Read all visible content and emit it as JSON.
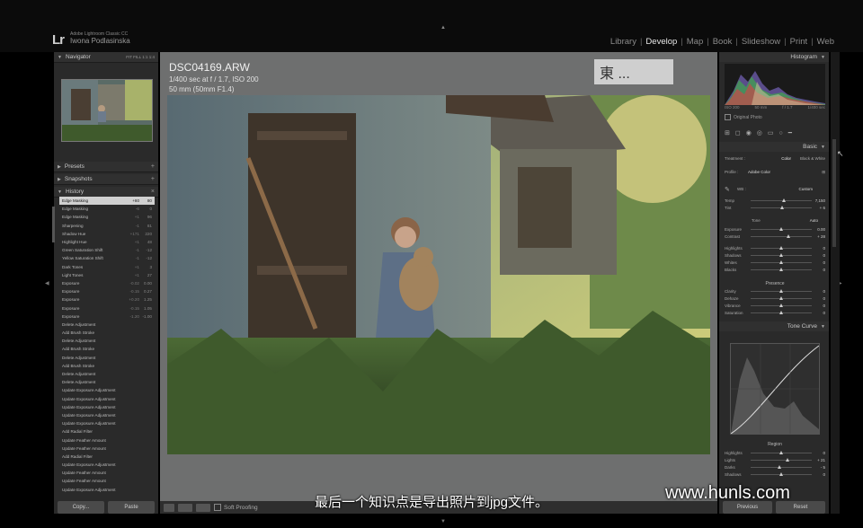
{
  "identity": {
    "small": "Adobe Lightroom Classic CC",
    "name": "Iwona Podlasinska",
    "logo": "Lr"
  },
  "modules": [
    "Library",
    "Develop",
    "Map",
    "Book",
    "Slideshow",
    "Print",
    "Web"
  ],
  "active_module": "Develop",
  "left": {
    "navigator": {
      "title": "Navigator",
      "zoom": "FIT  FILL  1:1  1:4"
    },
    "presets": "Presets",
    "snapshots": "Snapshots",
    "history": {
      "title": "History",
      "rows": [
        {
          "label": "Edge Masking",
          "v1": "+80",
          "v2": "80",
          "selected": true
        },
        {
          "label": "Edge Masking",
          "v1": "-6",
          "v2": "0"
        },
        {
          "label": "Edge Masking",
          "v1": "+1",
          "v2": "96"
        },
        {
          "label": "Sharpening",
          "v1": "-1",
          "v2": "81"
        },
        {
          "label": "Shadow Hue",
          "v1": "+171",
          "v2": "220"
        },
        {
          "label": "Highlight Hue",
          "v1": "+1",
          "v2": "48"
        },
        {
          "label": "Green Saturation Shift",
          "v1": "-1",
          "v2": "-12"
        },
        {
          "label": "Yellow Saturation Shift",
          "v1": "-1",
          "v2": "-12"
        },
        {
          "label": "Dark Tones",
          "v1": "+1",
          "v2": "3"
        },
        {
          "label": "Light Tones",
          "v1": "+1",
          "v2": "27"
        },
        {
          "label": "Exposure",
          "v1": "-0.02",
          "v2": "0.00"
        },
        {
          "label": "Exposure",
          "v1": "-0.15",
          "v2": "0.27"
        },
        {
          "label": "Exposure",
          "v1": "+0.20",
          "v2": "1.25"
        },
        {
          "label": "Exposure",
          "v1": "-0.15",
          "v2": "1.05"
        },
        {
          "label": "Exposure",
          "v1": "-1.20",
          "v2": "-1.00"
        },
        {
          "label": "Delete Adjustment",
          "v1": "",
          "v2": ""
        },
        {
          "label": "Add Brush Stroke",
          "v1": "",
          "v2": ""
        },
        {
          "label": "Delete Adjustment",
          "v1": "",
          "v2": ""
        },
        {
          "label": "Add Brush Stroke",
          "v1": "",
          "v2": ""
        },
        {
          "label": "Delete Adjustment",
          "v1": "",
          "v2": ""
        },
        {
          "label": "Add Brush Stroke",
          "v1": "",
          "v2": ""
        },
        {
          "label": "Delete Adjustment",
          "v1": "",
          "v2": ""
        },
        {
          "label": "Delete Adjustment",
          "v1": "",
          "v2": ""
        },
        {
          "label": "Update Exposure Adjustment",
          "v1": "",
          "v2": ""
        },
        {
          "label": "Update Exposure Adjustment",
          "v1": "",
          "v2": ""
        },
        {
          "label": "Update Exposure Adjustment",
          "v1": "",
          "v2": ""
        },
        {
          "label": "Update Exposure Adjustment",
          "v1": "",
          "v2": ""
        },
        {
          "label": "Update Exposure Adjustment",
          "v1": "",
          "v2": ""
        },
        {
          "label": "Add Radial Filter",
          "v1": "",
          "v2": ""
        },
        {
          "label": "Update Feather Amount",
          "v1": "",
          "v2": ""
        },
        {
          "label": "Update Feather Amount",
          "v1": "",
          "v2": ""
        },
        {
          "label": "Add Radial Filter",
          "v1": "",
          "v2": ""
        },
        {
          "label": "Update Exposure Adjustment",
          "v1": "",
          "v2": ""
        },
        {
          "label": "Update Feather Amount",
          "v1": "",
          "v2": ""
        },
        {
          "label": "Update Feather Amount",
          "v1": "",
          "v2": ""
        },
        {
          "label": "Update Exposure Adjustment",
          "v1": "",
          "v2": ""
        }
      ]
    },
    "copy_btn": "Copy...",
    "paste_btn": "Paste"
  },
  "photo": {
    "filename": "DSC04169.ARW",
    "exposure": "1/400 sec at f / 1.7, ISO 200",
    "focal": "50 mm (50mm F1.4)"
  },
  "toolbar": {
    "soft_proofing": "Soft Proofing"
  },
  "right": {
    "histogram_title": "Histogram",
    "hist_info": [
      "ISO 200",
      "50 mm",
      "f / 1.7",
      "1/400 sec"
    ],
    "original_photo": "Original Photo",
    "basic_title": "Basic",
    "treatment": {
      "label": "Treatment :",
      "color": "Color",
      "bw": "Black & White"
    },
    "profile": {
      "label": "Profile :",
      "value": "Adobe Color"
    },
    "wb": {
      "label": "WB :",
      "value": "Custom"
    },
    "wb_sliders": [
      {
        "label": "Temp",
        "value": "7,150",
        "pos": 0.55
      },
      {
        "label": "Tint",
        "value": "+ 6",
        "pos": 0.52
      }
    ],
    "tone_label": "Tone",
    "auto": "Auto",
    "tone_sliders": [
      {
        "label": "Exposure",
        "value": "0.00",
        "pos": 0.5
      },
      {
        "label": "Contrast",
        "value": "+ 28",
        "pos": 0.62
      }
    ],
    "hs_sliders": [
      {
        "label": "Highlights",
        "value": "0",
        "pos": 0.5
      },
      {
        "label": "Shadows",
        "value": "0",
        "pos": 0.5
      },
      {
        "label": "Whites",
        "value": "0",
        "pos": 0.5
      },
      {
        "label": "Blacks",
        "value": "0",
        "pos": 0.5
      }
    ],
    "presence_label": "Presence",
    "presence_sliders": [
      {
        "label": "Clarity",
        "value": "0",
        "pos": 0.5
      },
      {
        "label": "Dehaze",
        "value": "0",
        "pos": 0.5
      },
      {
        "label": "Vibrance",
        "value": "0",
        "pos": 0.5
      },
      {
        "label": "Saturation",
        "value": "0",
        "pos": 0.5
      }
    ],
    "tone_curve_title": "Tone Curve",
    "region_label": "Region",
    "region_sliders": [
      {
        "label": "Highlights",
        "value": "0",
        "pos": 0.5
      },
      {
        "label": "Lights",
        "value": "+ 21",
        "pos": 0.6
      },
      {
        "label": "Darks",
        "value": "- 5",
        "pos": 0.47
      },
      {
        "label": "Shadows",
        "value": "0",
        "pos": 0.5
      }
    ],
    "previous_btn": "Previous",
    "reset_btn": "Reset"
  },
  "overlay": {
    "subtitle": "最后一个知识点是导出照片到jpg文件。",
    "watermark": "www.hunls.com",
    "stamp": "東 ..."
  }
}
